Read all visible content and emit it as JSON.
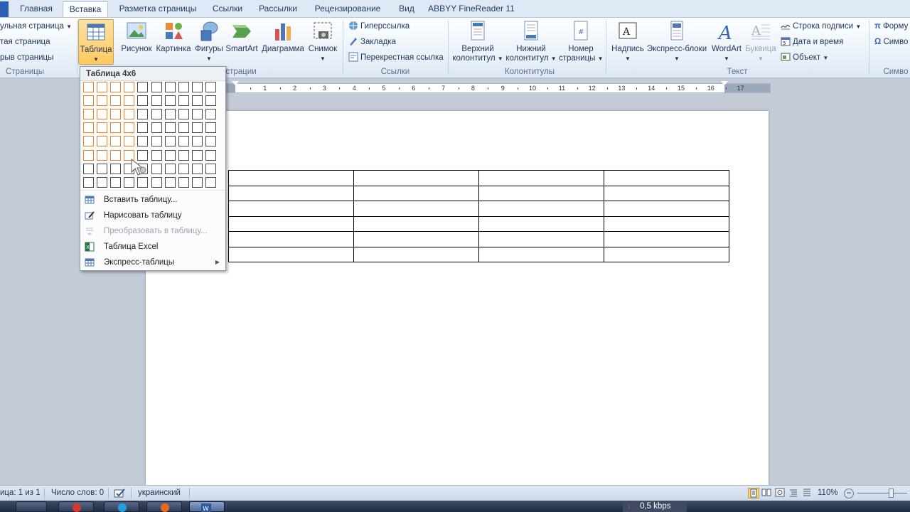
{
  "tabs": {
    "home": "Главная",
    "insert": "Вставка",
    "page_layout": "Разметка страницы",
    "references": "Ссылки",
    "mailings": "Рассылки",
    "review": "Рецензирование",
    "view": "Вид",
    "abbyy": "ABBYY FineReader 11"
  },
  "ribbon": {
    "pages": {
      "cover_page": "ульная страница",
      "blank_page": "тая страница",
      "page_break": "рыв страницы",
      "label": "Страницы"
    },
    "tables": {
      "table_label": "Таблица"
    },
    "illustrations": {
      "picture": "Рисунок",
      "clipart": "Картинка",
      "shapes": "Фигуры",
      "smartart": "SmartArt",
      "chart": "Диаграмма",
      "screenshot": "Снимок",
      "label_partial": "страции"
    },
    "links": {
      "hyperlink": "Гиперссылка",
      "bookmark": "Закладка",
      "cross_ref": "Перекрестная ссылка",
      "label": "Ссылки"
    },
    "header_footer": {
      "header_1": "Верхний",
      "header_2": "колонтитул",
      "footer_1": "Нижний",
      "footer_2": "колонтитул",
      "page_num_1": "Номер",
      "page_num_2": "страницы",
      "label": "Колонтитулы"
    },
    "text": {
      "textbox": "Надпись",
      "quickparts": "Экспресс-блоки",
      "wordart": "WordArt",
      "dropcap": "Буквица",
      "signature_line": "Строка подписи",
      "date_time": "Дата и время",
      "object": "Объект",
      "label": "Текст"
    },
    "symbols": {
      "equation": "Форму",
      "symbol": "Симво",
      "label": "Симво"
    }
  },
  "ruler_numbers": [
    "1",
    "2",
    "3",
    "4",
    "5",
    "6",
    "7",
    "8",
    "9",
    "10",
    "11",
    "12",
    "13",
    "14",
    "15",
    "16",
    "17"
  ],
  "dropdown": {
    "title": "Таблица 4x6",
    "grid_cols": 10,
    "grid_rows": 8,
    "selected_cols": 4,
    "selected_rows": 6,
    "highlight_color": "#e8822d",
    "items": [
      {
        "label": "Вставить таблицу...",
        "icon": "insert-table-icon",
        "disabled": false
      },
      {
        "label": "Нарисовать таблицу",
        "icon": "draw-table-icon",
        "disabled": false
      },
      {
        "label": "Преобразовать в таблицу...",
        "icon": "convert-table-icon",
        "disabled": true
      },
      {
        "label": "Таблица Excel",
        "icon": "excel-table-icon",
        "disabled": false
      },
      {
        "label": "Экспресс-таблицы",
        "icon": "quick-tables-icon",
        "disabled": false,
        "submenu": true
      }
    ]
  },
  "document": {
    "table_rows": 6,
    "table_cols": 4
  },
  "statusbar": {
    "page": "ица: 1 из 1",
    "words": "Число слов: 0",
    "language": "украинский",
    "zoom": "110%"
  },
  "taskbar": {
    "network": "0,5 kbps"
  }
}
